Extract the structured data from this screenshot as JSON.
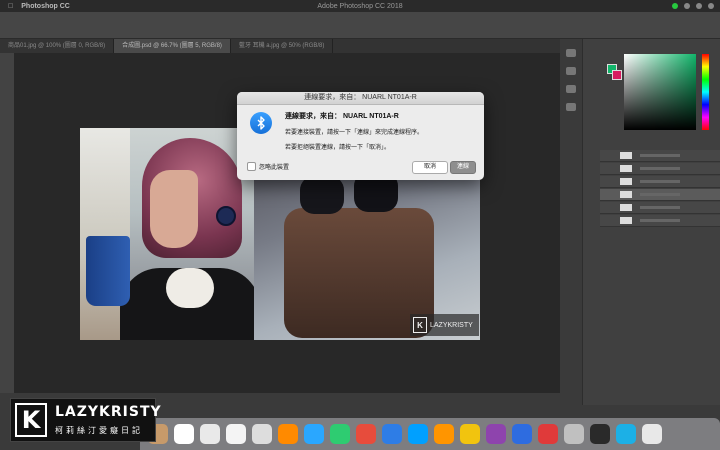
{
  "menubar": {
    "app_name": "Photoshop CC",
    "window_title": "Adobe Photoshop CC 2018"
  },
  "tabs": [
    "商品01.jpg @ 100% (圖層 0, RGB/8)",
    "合成圖.psd @ 66.7% (圖層 5, RGB/8)",
    "藍牙 耳機 a.jpg @ 50% (RGB/8)"
  ],
  "watermark_small": "LAZYKRISTY",
  "dialog": {
    "title": "連線要求，來自： NUARL NT01A-R",
    "heading": "連線要求，來自：  NUARL NT01A-R",
    "line1": "若要連接裝置，請按一下「連線」來完成連線程序。",
    "line2": "若要拒絕裝置連線，請按一下「取消」。",
    "checkbox_label": "忽略此裝置",
    "cancel_label": "取消",
    "connect_label": "連線"
  },
  "logo": {
    "letter": "K",
    "brand": "LAZYKRISTY",
    "subtitle": "柯莉絲汀愛癡日記"
  },
  "colors": {
    "foreground": "#11b56a",
    "background": "#d81b60",
    "bluetooth": "#1670d8"
  },
  "dock_apps": [
    "#c79a6a",
    "#fff",
    "#e9e9e9",
    "#f4f4f4",
    "#ddd",
    "#ff8a00",
    "#2aa7ff",
    "#2ecc71",
    "#e74c3c",
    "#2e7de6",
    "#00a0ff",
    "#ff9500",
    "#f1c40f",
    "#8e44ad",
    "#2e6ce0",
    "#e03a3a",
    "#c0c0c0",
    "#2a2a2a",
    "#1cb0e6",
    "#e8e8e8"
  ]
}
